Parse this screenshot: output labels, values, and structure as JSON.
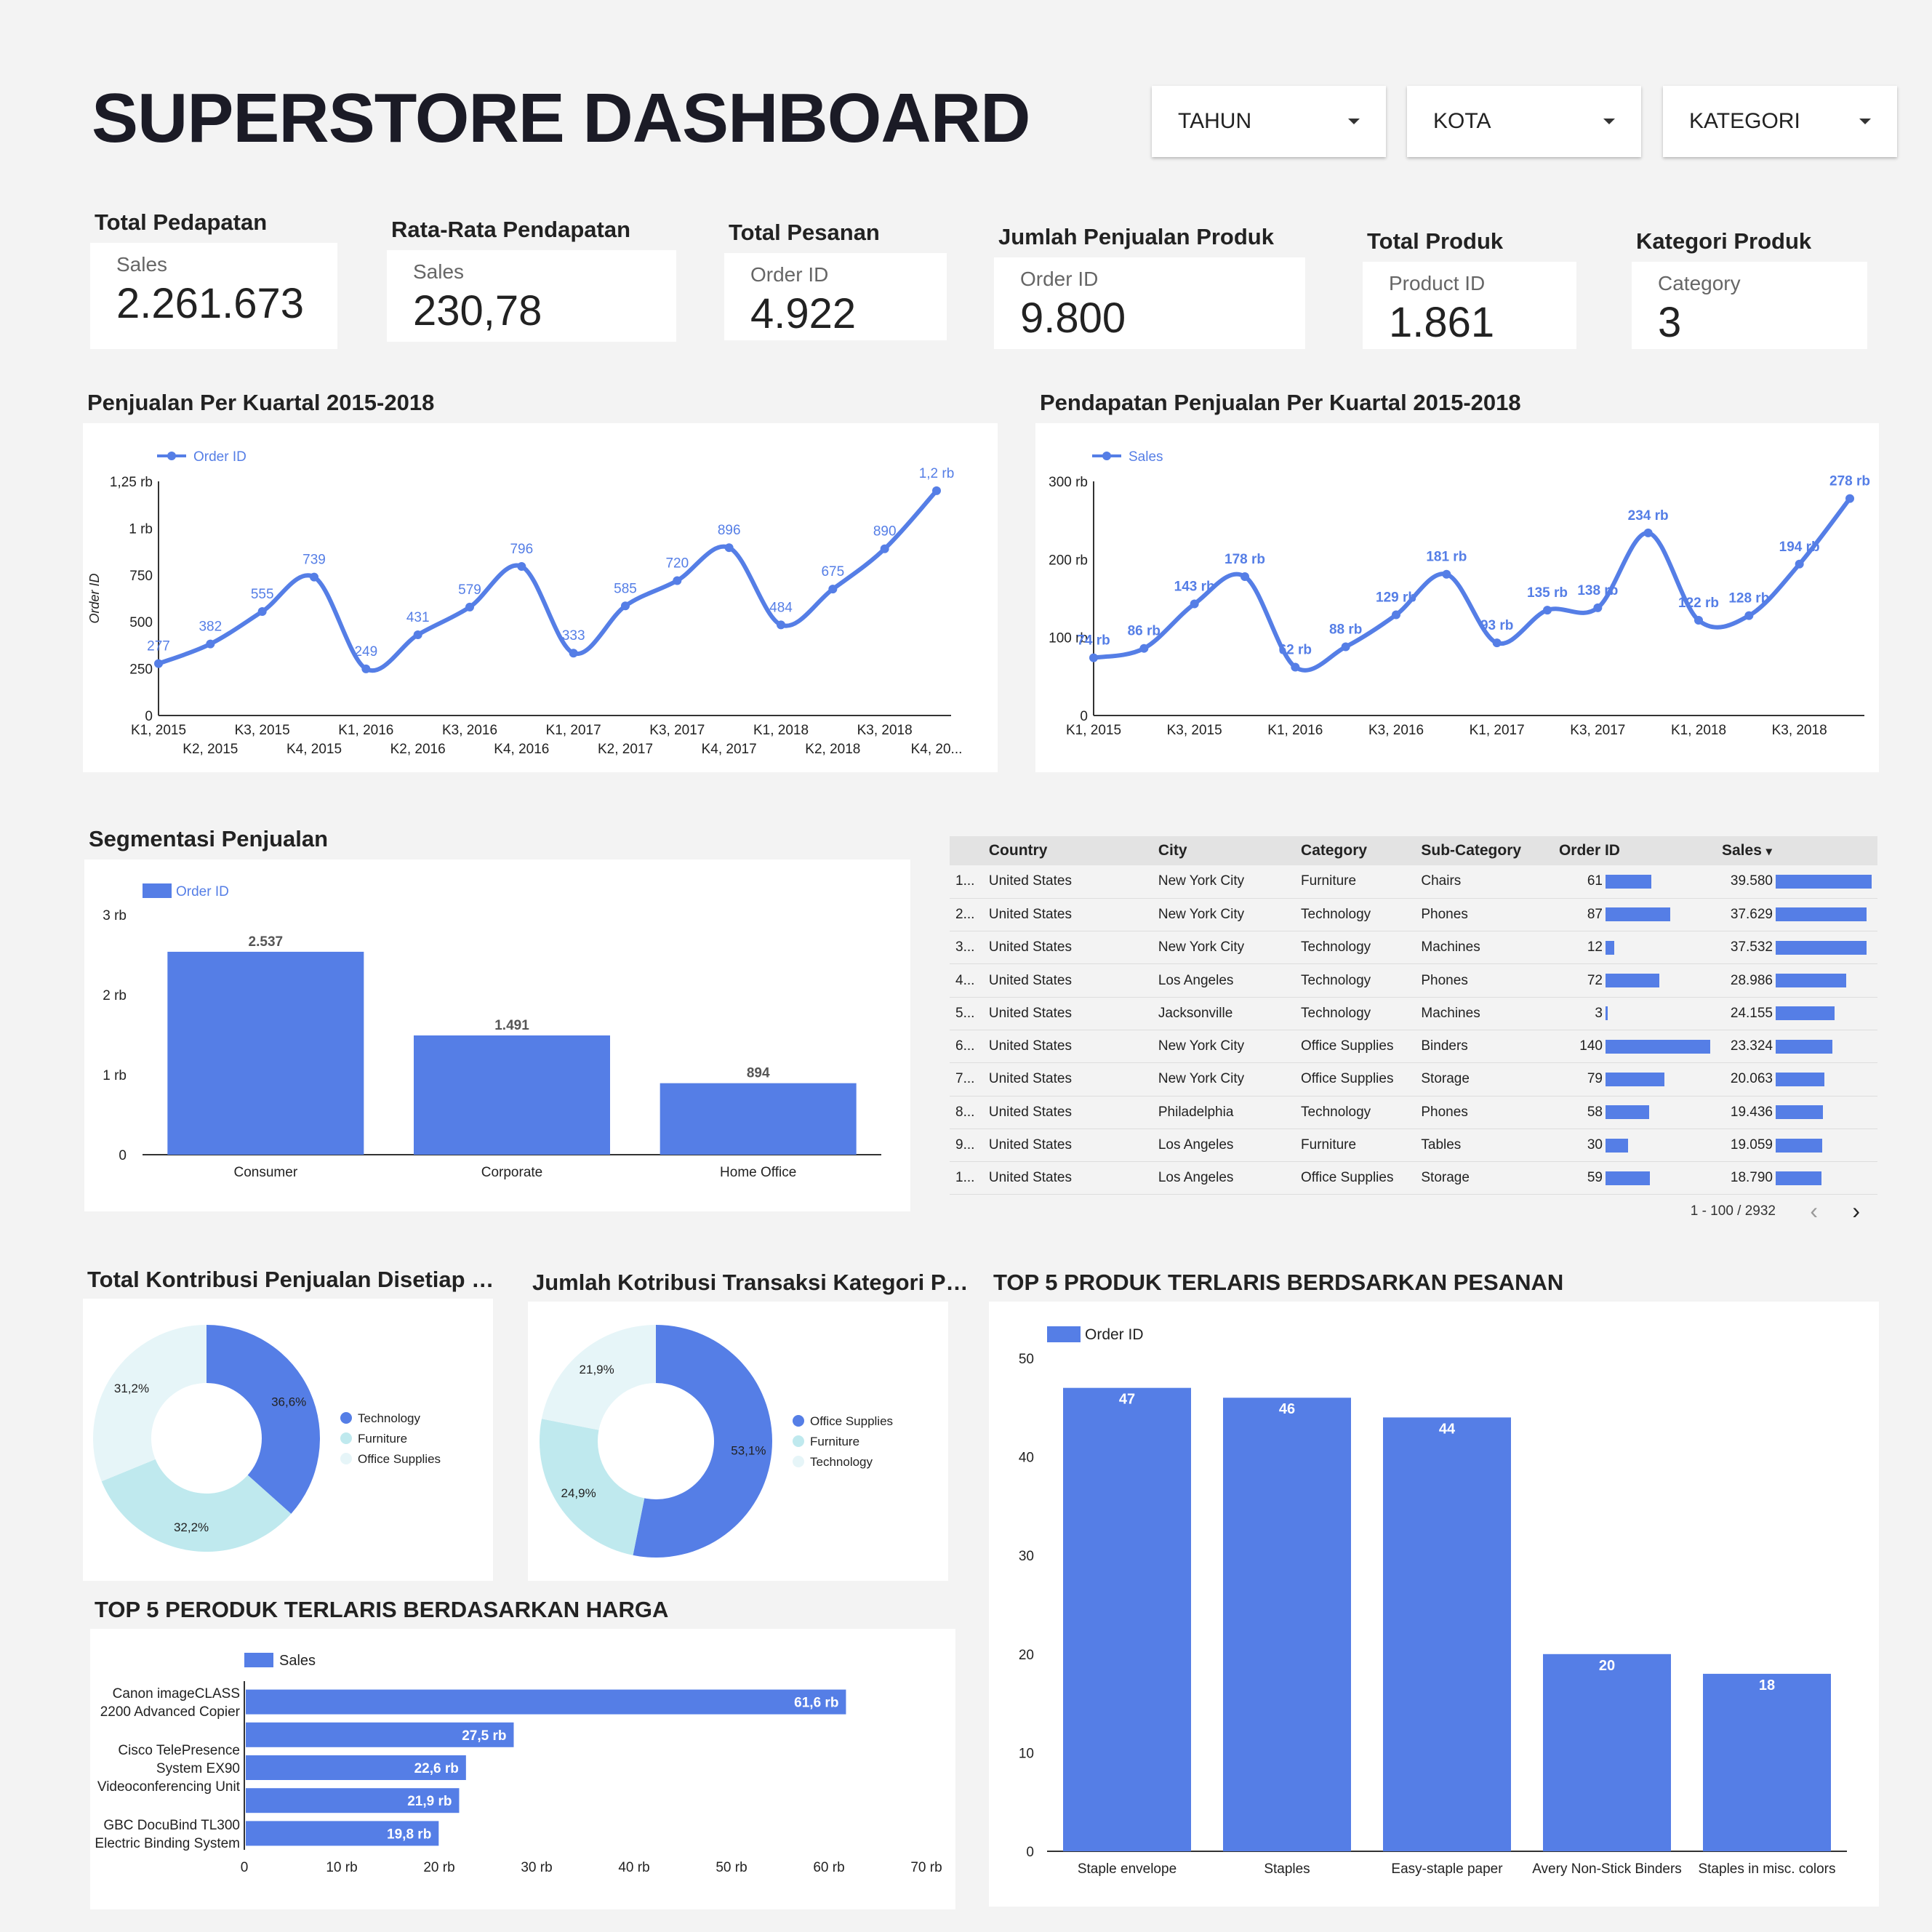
{
  "header": {
    "title": "SUPERSTORE DASHBOARD"
  },
  "filters": [
    {
      "label": "TAHUN"
    },
    {
      "label": "KOTA"
    },
    {
      "label": "KATEGORI"
    }
  ],
  "kpis": [
    {
      "title": "Total Pedapatan",
      "label": "Sales",
      "value": "2.261.673"
    },
    {
      "title": "Rata-Rata Pendapatan",
      "label": "Sales",
      "value": "230,78"
    },
    {
      "title": "Total Pesanan",
      "label": "Order ID",
      "value": "4.922"
    },
    {
      "title": "Jumlah Penjualan Produk",
      "label": "Order ID",
      "value": "9.800"
    },
    {
      "title": "Total Produk",
      "label": "Product ID",
      "value": "1.861"
    },
    {
      "title": "Kategori Produk",
      "label": "Category",
      "value": "3"
    }
  ],
  "colors": {
    "accent": "#557ee6",
    "light": "#bfe9ee",
    "lighter": "#e6f5f8",
    "background": "#f3f3f3"
  },
  "sections": {
    "line1": "Penjualan Per Kuartal 2015-2018",
    "line2": "Pendapatan Penjualan Per Kuartal 2015-2018",
    "segment": "Segmentasi Penjualan",
    "donut1": "Total Kontribusi Penjualan Disetiap Kateg...",
    "donut2": "Jumlah Kotribusi Transaksi Kategori Produk",
    "top_orders": "TOP 5 PRODUK TERLARIS BERDSARKAN PESANAN",
    "top_price": "TOP 5 PERODUK TERLARIS BERDASARKAN HARGA"
  },
  "table": {
    "headers": [
      "Country",
      "City",
      "Category",
      "Sub-Category",
      "Order ID",
      "Sales"
    ],
    "sort_indicator": "▾",
    "rows": [
      {
        "idx": "1...",
        "country": "United States",
        "city": "New York City",
        "category": "Furniture",
        "sub": "Chairs",
        "orders": 61,
        "orders_label": "61",
        "sales": 39580,
        "sales_label": "39.580"
      },
      {
        "idx": "2...",
        "country": "United States",
        "city": "New York City",
        "category": "Technology",
        "sub": "Phones",
        "orders": 87,
        "orders_label": "87",
        "sales": 37629,
        "sales_label": "37.629"
      },
      {
        "idx": "3...",
        "country": "United States",
        "city": "New York City",
        "category": "Technology",
        "sub": "Machines",
        "orders": 12,
        "orders_label": "12",
        "sales": 37532,
        "sales_label": "37.532"
      },
      {
        "idx": "4...",
        "country": "United States",
        "city": "Los Angeles",
        "category": "Technology",
        "sub": "Phones",
        "orders": 72,
        "orders_label": "72",
        "sales": 28986,
        "sales_label": "28.986"
      },
      {
        "idx": "5...",
        "country": "United States",
        "city": "Jacksonville",
        "category": "Technology",
        "sub": "Machines",
        "orders": 3,
        "orders_label": "3",
        "sales": 24155,
        "sales_label": "24.155"
      },
      {
        "idx": "6...",
        "country": "United States",
        "city": "New York City",
        "category": "Office Supplies",
        "sub": "Binders",
        "orders": 140,
        "orders_label": "140",
        "sales": 23324,
        "sales_label": "23.324"
      },
      {
        "idx": "7...",
        "country": "United States",
        "city": "New York City",
        "category": "Office Supplies",
        "sub": "Storage",
        "orders": 79,
        "orders_label": "79",
        "sales": 20063,
        "sales_label": "20.063"
      },
      {
        "idx": "8...",
        "country": "United States",
        "city": "Philadelphia",
        "category": "Technology",
        "sub": "Phones",
        "orders": 58,
        "orders_label": "58",
        "sales": 19436,
        "sales_label": "19.436"
      },
      {
        "idx": "9...",
        "country": "United States",
        "city": "Los Angeles",
        "category": "Furniture",
        "sub": "Tables",
        "orders": 30,
        "orders_label": "30",
        "sales": 19059,
        "sales_label": "19.059"
      },
      {
        "idx": "1...",
        "country": "United States",
        "city": "Los Angeles",
        "category": "Office Supplies",
        "sub": "Storage",
        "orders": 59,
        "orders_label": "59",
        "sales": 18790,
        "sales_label": "18.790"
      }
    ],
    "pagination": "1 - 100 / 2932"
  },
  "chart_data": [
    {
      "id": "line1",
      "type": "line",
      "legend": "Order ID",
      "ylabel": "Order ID",
      "ylim": [
        0,
        1250
      ],
      "yticks": [
        0,
        250,
        500,
        750,
        1000,
        1250
      ],
      "ytick_labels": [
        "0",
        "250",
        "500",
        "750",
        "1 rb",
        "1,25 rb"
      ],
      "x": [
        "K1, 2015",
        "K2, 2015",
        "K3, 2015",
        "K4, 2015",
        "K1, 2016",
        "K2, 2016",
        "K3, 2016",
        "K4, 2016",
        "K1, 2017",
        "K2, 2017",
        "K3, 2017",
        "K4, 2017",
        "K1, 2018",
        "K2, 2018",
        "K3, 2018",
        "K4, 20..."
      ],
      "values": [
        277,
        382,
        555,
        739,
        249,
        431,
        579,
        796,
        333,
        585,
        720,
        896,
        484,
        675,
        890,
        1200
      ],
      "labels": [
        "277",
        "382",
        "555",
        "739",
        "249",
        "431",
        "579",
        "796",
        "333",
        "585",
        "720",
        "896",
        "484",
        "675",
        "890",
        "1,2 rb"
      ]
    },
    {
      "id": "line2",
      "type": "line",
      "legend": "Sales",
      "ylim": [
        0,
        300000
      ],
      "yticks": [
        0,
        100000,
        200000,
        300000
      ],
      "ytick_labels": [
        "0",
        "100 rb",
        "200 rb",
        "300 rb"
      ],
      "x": [
        "K1, 2015",
        "",
        "K3, 2015",
        "",
        "K1, 2016",
        "",
        "K3, 2016",
        "",
        "K1, 2017",
        "",
        "K3, 2017",
        "",
        "K1, 2018",
        "",
        "K3, 2018",
        ""
      ],
      "values": [
        74000,
        86000,
        143000,
        178000,
        62000,
        88000,
        129000,
        181000,
        93000,
        135000,
        138000,
        234000,
        122000,
        128000,
        194000,
        278000
      ],
      "labels": [
        "74 rb",
        "86 rb",
        "143 rb",
        "178 rb",
        "62 rb",
        "88 rb",
        "129 rb",
        "181 rb",
        "93 rb",
        "135 rb",
        "138 rb",
        "234 rb",
        "122 rb",
        "128 rb",
        "194 rb",
        "278 rb"
      ]
    },
    {
      "id": "segment",
      "type": "bar",
      "legend": "Order ID",
      "ylim": [
        0,
        3000
      ],
      "yticks": [
        0,
        1000,
        2000,
        3000
      ],
      "ytick_labels": [
        "0",
        "1 rb",
        "2 rb",
        "3 rb"
      ],
      "categories": [
        "Consumer",
        "Corporate",
        "Home Office"
      ],
      "values": [
        2537,
        1491,
        894
      ],
      "labels": [
        "2.537",
        "1.491",
        "894"
      ]
    },
    {
      "id": "donut1",
      "type": "pie",
      "slices": [
        {
          "name": "Technology",
          "value": 36.6,
          "label": "36,6%",
          "color": "#557ee6"
        },
        {
          "name": "Furniture",
          "value": 32.2,
          "label": "32,2%",
          "color": "#bfe9ee"
        },
        {
          "name": "Office Supplies",
          "value": 31.2,
          "label": "31,2%",
          "color": "#e6f5f8"
        }
      ]
    },
    {
      "id": "donut2",
      "type": "pie",
      "slices": [
        {
          "name": "Office Supplies",
          "value": 53.1,
          "label": "53,1%",
          "color": "#557ee6"
        },
        {
          "name": "Furniture",
          "value": 24.9,
          "label": "24,9%",
          "color": "#bfe9ee"
        },
        {
          "name": "Technology",
          "value": 21.9,
          "label": "21,9%",
          "color": "#e6f5f8"
        }
      ]
    },
    {
      "id": "top_orders",
      "type": "bar",
      "legend": "Order ID",
      "ylim": [
        0,
        50
      ],
      "yticks": [
        0,
        10,
        20,
        30,
        40,
        50
      ],
      "ytick_labels": [
        "0",
        "10",
        "20",
        "30",
        "40",
        "50"
      ],
      "categories": [
        "Staple envelope",
        "Staples",
        "Easy-staple paper",
        "Avery Non-Stick Binders",
        "Staples in misc. colors"
      ],
      "values": [
        47,
        46,
        44,
        20,
        18
      ],
      "labels": [
        "47",
        "46",
        "44",
        "20",
        "18"
      ]
    },
    {
      "id": "top_price",
      "type": "bar",
      "orientation": "horizontal",
      "legend": "Sales",
      "xlim": [
        0,
        70000
      ],
      "xticks": [
        0,
        10000,
        20000,
        30000,
        40000,
        50000,
        60000,
        70000
      ],
      "xtick_labels": [
        "0",
        "10 rb",
        "20 rb",
        "30 rb",
        "40 rb",
        "50 rb",
        "60 rb",
        "70 rb"
      ],
      "values": [
        61600,
        27500,
        22600,
        21900,
        19800
      ],
      "labels": [
        "61,6 rb",
        "27,5 rb",
        "22,6 rb",
        "21,9 rb",
        "19,8 rb"
      ],
      "category_labels": [
        {
          "bar": 0,
          "lines": [
            "Canon imageCLASS",
            "2200 Advanced Copier"
          ]
        },
        {
          "bar": 2,
          "lines": [
            "Cisco TelePresence",
            "System EX90",
            "Videoconferencing Unit"
          ]
        },
        {
          "bar": 4,
          "lines": [
            "GBC DocuBind TL300",
            "Electric Binding System"
          ]
        }
      ]
    }
  ]
}
